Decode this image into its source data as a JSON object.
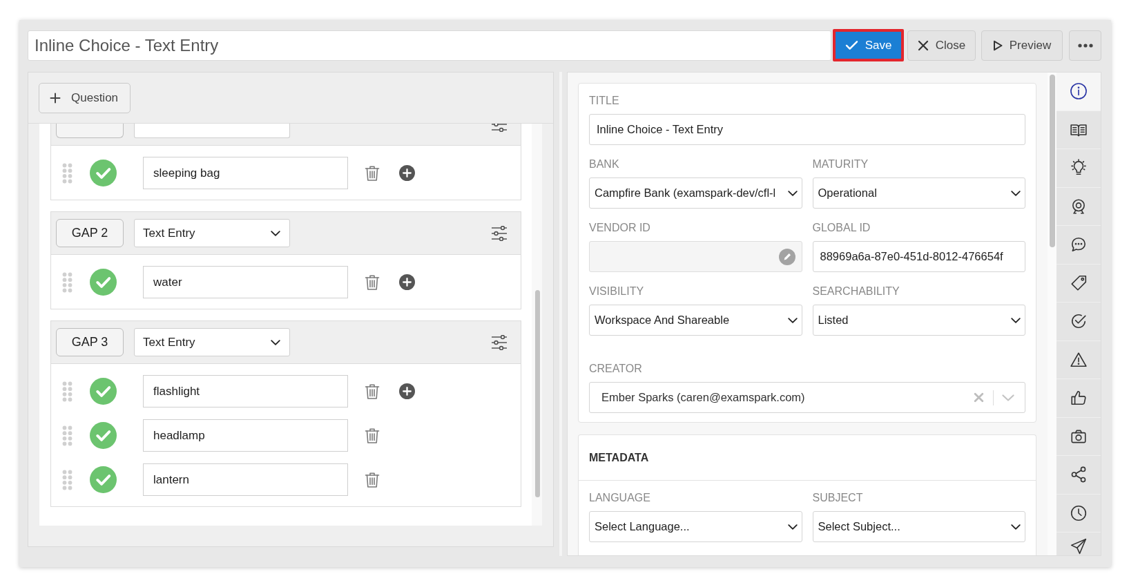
{
  "toolbar": {
    "title": "Inline Choice - Text Entry",
    "buttons": [
      {
        "kind": "save",
        "label": "Save",
        "highlighted": true
      },
      {
        "kind": "close",
        "label": "Close",
        "highlighted": false
      },
      {
        "kind": "preview",
        "label": "Preview",
        "highlighted": false
      },
      {
        "kind": "more",
        "highlighted": false
      }
    ]
  },
  "question_editor": {
    "add_button": {
      "label": "Question"
    },
    "gaps": [
      {
        "answers": [
          {
            "value": "sleeping bag",
            "correct": true,
            "can_add": true
          }
        ]
      },
      {
        "label": "GAP 2",
        "type": "Text Entry",
        "answers": [
          {
            "value": "water",
            "correct": true,
            "can_add": true
          }
        ]
      },
      {
        "label": "GAP 3",
        "type": "Text Entry",
        "answers": [
          {
            "value": "flashlight",
            "correct": true,
            "can_add": true
          },
          {
            "value": "headlamp",
            "correct": true,
            "can_add": false
          },
          {
            "value": "lantern",
            "correct": true,
            "can_add": false
          }
        ]
      }
    ]
  },
  "details": {
    "sections": [
      {
        "rows": [
          [
            {
              "kind": "text",
              "label": "TITLE",
              "value": "Inline Choice - Text Entry"
            }
          ],
          [
            {
              "kind": "select",
              "label": "BANK",
              "value": "Campfire Bank (examspark-dev/cfl-l"
            },
            {
              "kind": "select",
              "label": "MATURITY",
              "value": "Operational"
            }
          ],
          [
            {
              "kind": "locked",
              "label": "VENDOR ID"
            },
            {
              "kind": "text",
              "label": "GLOBAL ID",
              "value": "88969a6a-87e0-451d-8012-476654f"
            }
          ],
          [
            {
              "kind": "select",
              "label": "VISIBILITY",
              "value": "Workspace And Shareable"
            },
            {
              "kind": "select",
              "label": "SEARCHABILITY",
              "value": "Listed"
            }
          ],
          [
            {
              "kind": "combobox",
              "label": "CREATOR",
              "value": "Ember Sparks (caren@examspark.com)"
            }
          ]
        ]
      },
      {
        "title": "METADATA",
        "rows": [
          [
            {
              "kind": "select",
              "label": "LANGUAGE",
              "placeholder": "Select Language..."
            },
            {
              "kind": "select",
              "label": "SUBJECT",
              "placeholder": "Select Subject..."
            }
          ]
        ]
      }
    ]
  },
  "sidebar": {
    "tabs": [
      {
        "kind": "info",
        "selected": true
      },
      {
        "kind": "book",
        "selected": false
      },
      {
        "kind": "bulb",
        "selected": false
      },
      {
        "kind": "webcam",
        "selected": false
      },
      {
        "kind": "comment",
        "selected": false
      },
      {
        "kind": "tag",
        "selected": false
      },
      {
        "kind": "check",
        "selected": false
      },
      {
        "kind": "warning",
        "selected": false
      },
      {
        "kind": "thumbs_up",
        "selected": false
      },
      {
        "kind": "camera",
        "selected": false
      },
      {
        "kind": "share",
        "selected": false
      },
      {
        "kind": "clock",
        "selected": false
      },
      {
        "kind": "send",
        "selected": false
      }
    ]
  }
}
